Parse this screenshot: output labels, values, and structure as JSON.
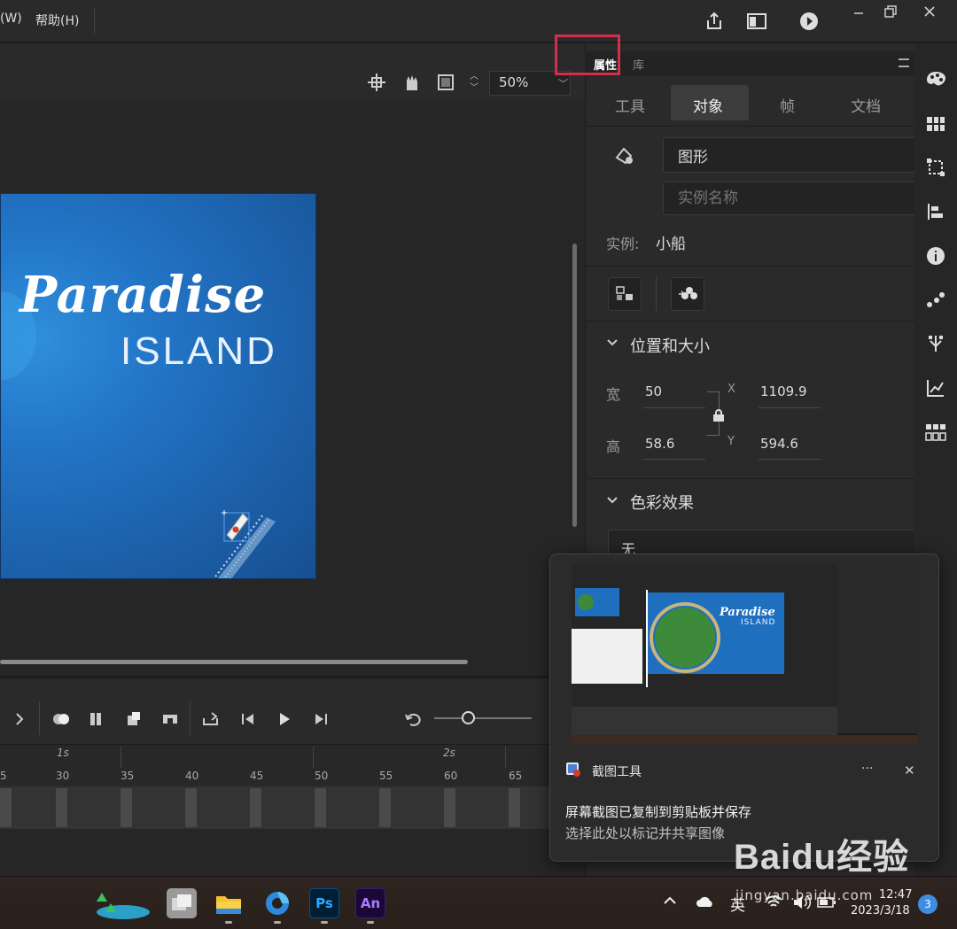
{
  "menubar": {
    "window_label": "(W)",
    "help_label": "帮助(H)"
  },
  "stage": {
    "zoom": "50%",
    "title_line1": "Paradise",
    "title_line2": "ISLAND"
  },
  "panel": {
    "tabs": [
      "属性",
      "库"
    ],
    "subtabs": [
      "工具",
      "对象",
      "帧",
      "文档"
    ],
    "selected_subtab": "对象",
    "symbol_type": "图形",
    "instance_name_placeholder": "实例名称",
    "instance_label": "实例:",
    "instance_value": "小船",
    "position_size": {
      "header": "位置和大小",
      "width_label": "宽",
      "width": "50",
      "height_label": "高",
      "height": "58.6",
      "x_label": "X",
      "x": "1109.9",
      "y_label": "Y",
      "y": "594.6"
    },
    "color_effect": {
      "header": "色彩效果",
      "value": "无"
    }
  },
  "timeline": {
    "second_markers": [
      "1s",
      "2s"
    ],
    "frame_numbers": [
      "5",
      "30",
      "35",
      "40",
      "45",
      "50",
      "55",
      "60",
      "65"
    ]
  },
  "toast": {
    "app_name": "截图工具",
    "message": "屏幕截图已复制到剪贴板并保存",
    "sub": "选择此处以标记并共享图像",
    "more": "···",
    "close": "✕",
    "thumb_title": "Paradise",
    "thumb_sub": "ISLAND"
  },
  "taskbar": {
    "ps_label": "Ps",
    "an_label": "An",
    "ime": "英",
    "time": "12:47",
    "date": "2023/3/18",
    "notif_count": "3"
  },
  "watermark": {
    "brand": "Baidu经验",
    "url": "jingyan.baidu.com"
  },
  "colors": {
    "highlight": "#d0304a",
    "stage_blue": "#2376c8",
    "ps_bg": "#001e36",
    "an_bg": "#1b0838"
  }
}
